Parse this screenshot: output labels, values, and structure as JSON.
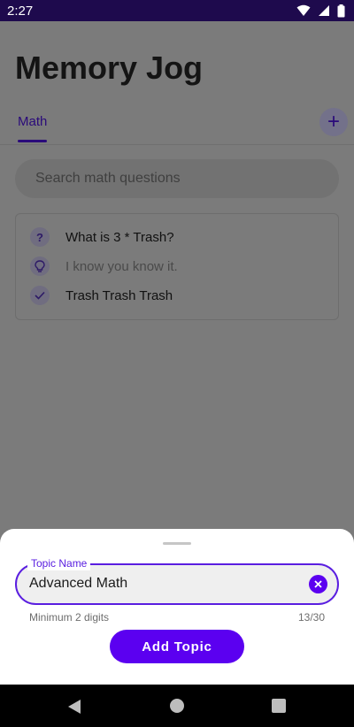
{
  "status_bar": {
    "time": "2:27"
  },
  "app": {
    "title": "Memory Jog",
    "tabs": [
      {
        "label": "Math",
        "selected": true
      }
    ],
    "search_placeholder": "Search math questions",
    "card": {
      "question": "What is 3 * Trash?",
      "hint": "I know you know it.",
      "answer": "Trash Trash Trash"
    }
  },
  "sheet": {
    "field_label": "Topic Name",
    "field_value": "Advanced Math",
    "helper_text": "Minimum 2 digits",
    "counter": "13/30",
    "submit_label": "Add Topic"
  },
  "icons": {
    "add_tab": "plus-icon",
    "question": "question-mark-icon",
    "hint": "lightbulb-icon",
    "answer": "checkmark-icon",
    "clear": "clear-icon"
  },
  "colors": {
    "accent": "#5b00f0",
    "status_bar": "#1e0a4d",
    "scrim": "#7b7b7b",
    "tab_selected": "#2a0a7a"
  }
}
